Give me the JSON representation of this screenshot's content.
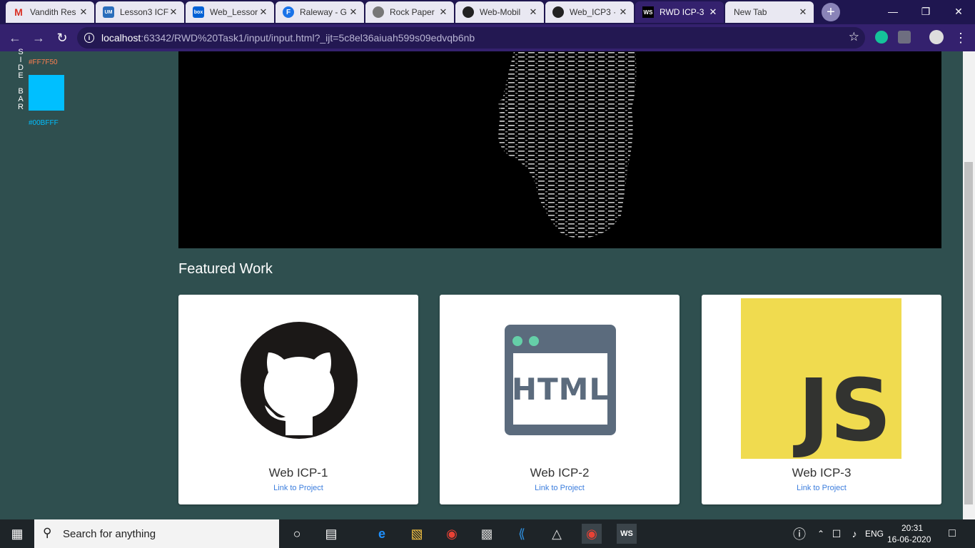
{
  "browser": {
    "tabs": [
      {
        "title": "Vandith Res",
        "icon": "gmail-icon"
      },
      {
        "title": "Lesson3 ICF",
        "icon": "umkc-icon"
      },
      {
        "title": "Web_Lessor",
        "icon": "box-icon"
      },
      {
        "title": "Raleway - G",
        "icon": "fonts-icon"
      },
      {
        "title": "Rock Paper",
        "icon": "chrome-icon"
      },
      {
        "title": "Web-Mobil",
        "icon": "github-icon"
      },
      {
        "title": "Web_ICP3 ·",
        "icon": "github-icon"
      },
      {
        "title": "RWD ICP-3",
        "icon": "webstorm-icon"
      },
      {
        "title": "New Tab",
        "icon": ""
      }
    ],
    "url_host": "localhost",
    "url_rest": ":63342/RWD%20Task1/input/input.html?_ijt=5c8el36aiuah599s09edvqb6nb"
  },
  "sidebar": {
    "letters": [
      "S",
      "I",
      "D",
      "E",
      "",
      "B",
      "A",
      "R"
    ],
    "swatch1_label": "#FF7F50",
    "swatch2_label": "#00BFFF",
    "swatch1_color": "#FF7F50",
    "swatch2_color": "#00BFFF"
  },
  "featured": {
    "heading": "Featured Work",
    "cards": [
      {
        "title": "Web ICP-1",
        "link": "Link to Project",
        "image": "github-logo-icon"
      },
      {
        "title": "Web ICP-2",
        "link": "Link to Project",
        "image": "html-logo-icon"
      },
      {
        "title": "Web ICP-3",
        "link": "Link to Project",
        "image": "js-logo-icon"
      }
    ],
    "html_logo_text": "HTML",
    "js_logo_text": "JS"
  },
  "taskbar": {
    "search_placeholder": "Search for anything",
    "language": "ENG",
    "time": "20:31",
    "date": "16-06-2020"
  }
}
